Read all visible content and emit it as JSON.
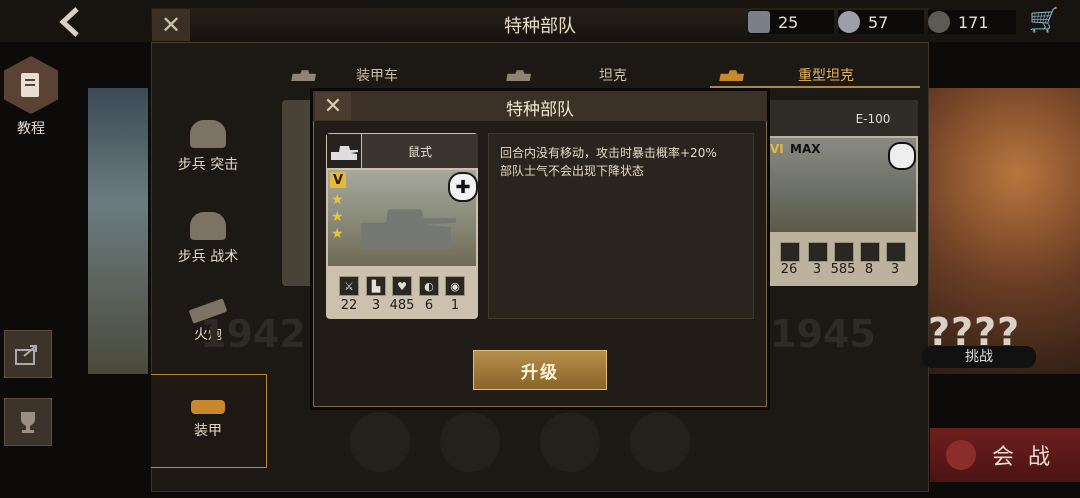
{
  "header": {
    "title": "特种部队",
    "resources": [
      {
        "icon": "tank-chip-icon",
        "value": "25"
      },
      {
        "icon": "medal-icon",
        "value": "57"
      },
      {
        "icon": "laurel-icon",
        "value": "171"
      }
    ],
    "cart_icon": "cart-icon"
  },
  "left_nav": {
    "tutorial_label": "教程"
  },
  "tabs": [
    {
      "label": "装甲车",
      "active": false
    },
    {
      "label": "坦克",
      "active": false
    },
    {
      "label": "重型坦克",
      "active": true
    }
  ],
  "categories": [
    {
      "label": "步兵 突击"
    },
    {
      "label": "步兵 战术"
    },
    {
      "label": "火炮"
    },
    {
      "label": "装甲",
      "active": true
    }
  ],
  "background": {
    "years": [
      "1942",
      "1945"
    ],
    "e100": {
      "name": "E-100",
      "rank": "VI",
      "max": "MAX",
      "stats": [
        "26",
        "3",
        "585",
        "8",
        "3"
      ]
    },
    "challenge_label": "挑战",
    "unknown_label": "????",
    "battle_label": "会战"
  },
  "modal": {
    "title": "特种部队",
    "card": {
      "name": "鼠式",
      "rank": "V",
      "stars": 3,
      "stats": [
        "22",
        "3",
        "485",
        "6",
        "1"
      ]
    },
    "description": [
      "回合内没有移动，攻击时暴击概率+20%",
      "部队士气不会出现下降状态"
    ],
    "upgrade_label": "升级"
  }
}
